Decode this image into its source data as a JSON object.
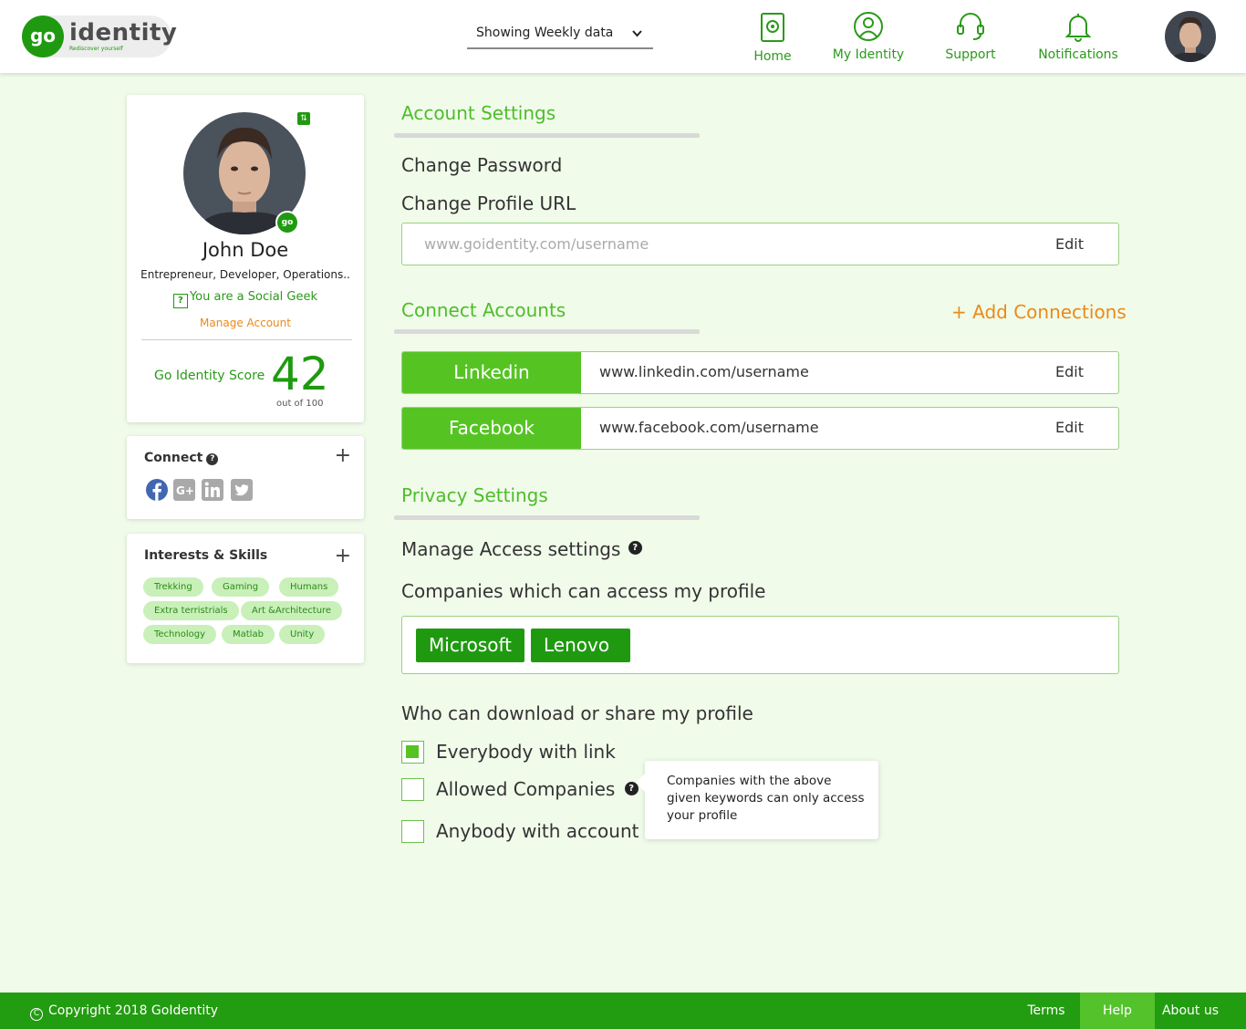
{
  "brand": {
    "logo_mark": "go",
    "logo_word": "identity",
    "tagline": "Rediscover yourself"
  },
  "header": {
    "period_select": {
      "value": "Showing Weekly data",
      "icon": "chevron-down-icon"
    },
    "nav": [
      {
        "label": "Home",
        "icon": "home-icon"
      },
      {
        "label": "My Identity",
        "icon": "user-circle-icon"
      },
      {
        "label": "Support",
        "icon": "headset-icon"
      },
      {
        "label": "Notifications",
        "icon": "bell-icon"
      }
    ]
  },
  "profile": {
    "name": "John Doe",
    "tagline": "Entrepreneur, Developer, Operations..",
    "badge": "go",
    "social_type": "You are a Social Geek",
    "social_type_icon": "?",
    "manage_account": "Manage Account",
    "score_label": "Go Identity Score",
    "score": "42",
    "score_sub": "out of 100"
  },
  "connect": {
    "title": "Connect",
    "add": "+",
    "icons": [
      "facebook-icon",
      "google-plus-icon",
      "linkedin-icon",
      "twitter-icon"
    ]
  },
  "interests": {
    "title": "Interests & Skills",
    "add": "+",
    "chips": [
      "Trekking",
      "Gaming",
      "Humans",
      "Extra terristrials",
      "Art &Architecture",
      "Technology",
      "Matlab",
      "Unity"
    ]
  },
  "account_settings": {
    "title": "Account Settings",
    "change_password": "Change Password",
    "change_profile_url": "Change Profile URL",
    "url_placeholder": "www.goidentity.com/username",
    "edit": "Edit"
  },
  "connect_accounts": {
    "title": "Connect Accounts",
    "add_connections": "+ Add Connections",
    "accounts": [
      {
        "name": "Linkedin",
        "url": "www.linkedin.com/username",
        "edit": "Edit"
      },
      {
        "name": "Facebook",
        "url": "www.facebook.com/username",
        "edit": "Edit"
      }
    ]
  },
  "privacy": {
    "title": "Privacy Settings",
    "manage_access": "Manage Access settings",
    "companies_label": "Companies which can access my profile",
    "companies": [
      "Microsoft",
      "Lenovo"
    ],
    "download_label": "Who can download or share my profile",
    "options": [
      {
        "label": "Everybody with link",
        "checked": true
      },
      {
        "label": "Allowed Companies",
        "checked": false
      },
      {
        "label": "Anybody with account UI",
        "checked": false
      }
    ],
    "tooltip": "Companies with the above given keywords can only access your profile"
  },
  "footer": {
    "copyright": "Copyright 2018 GoIdentity",
    "links": [
      "Terms",
      "Help",
      "About us"
    ],
    "active_link": "Help"
  },
  "colors": {
    "brand_green": "#1f9a10",
    "accent_green": "#55c423",
    "orange": "#ea8a1a",
    "background": "#f0fbea"
  }
}
